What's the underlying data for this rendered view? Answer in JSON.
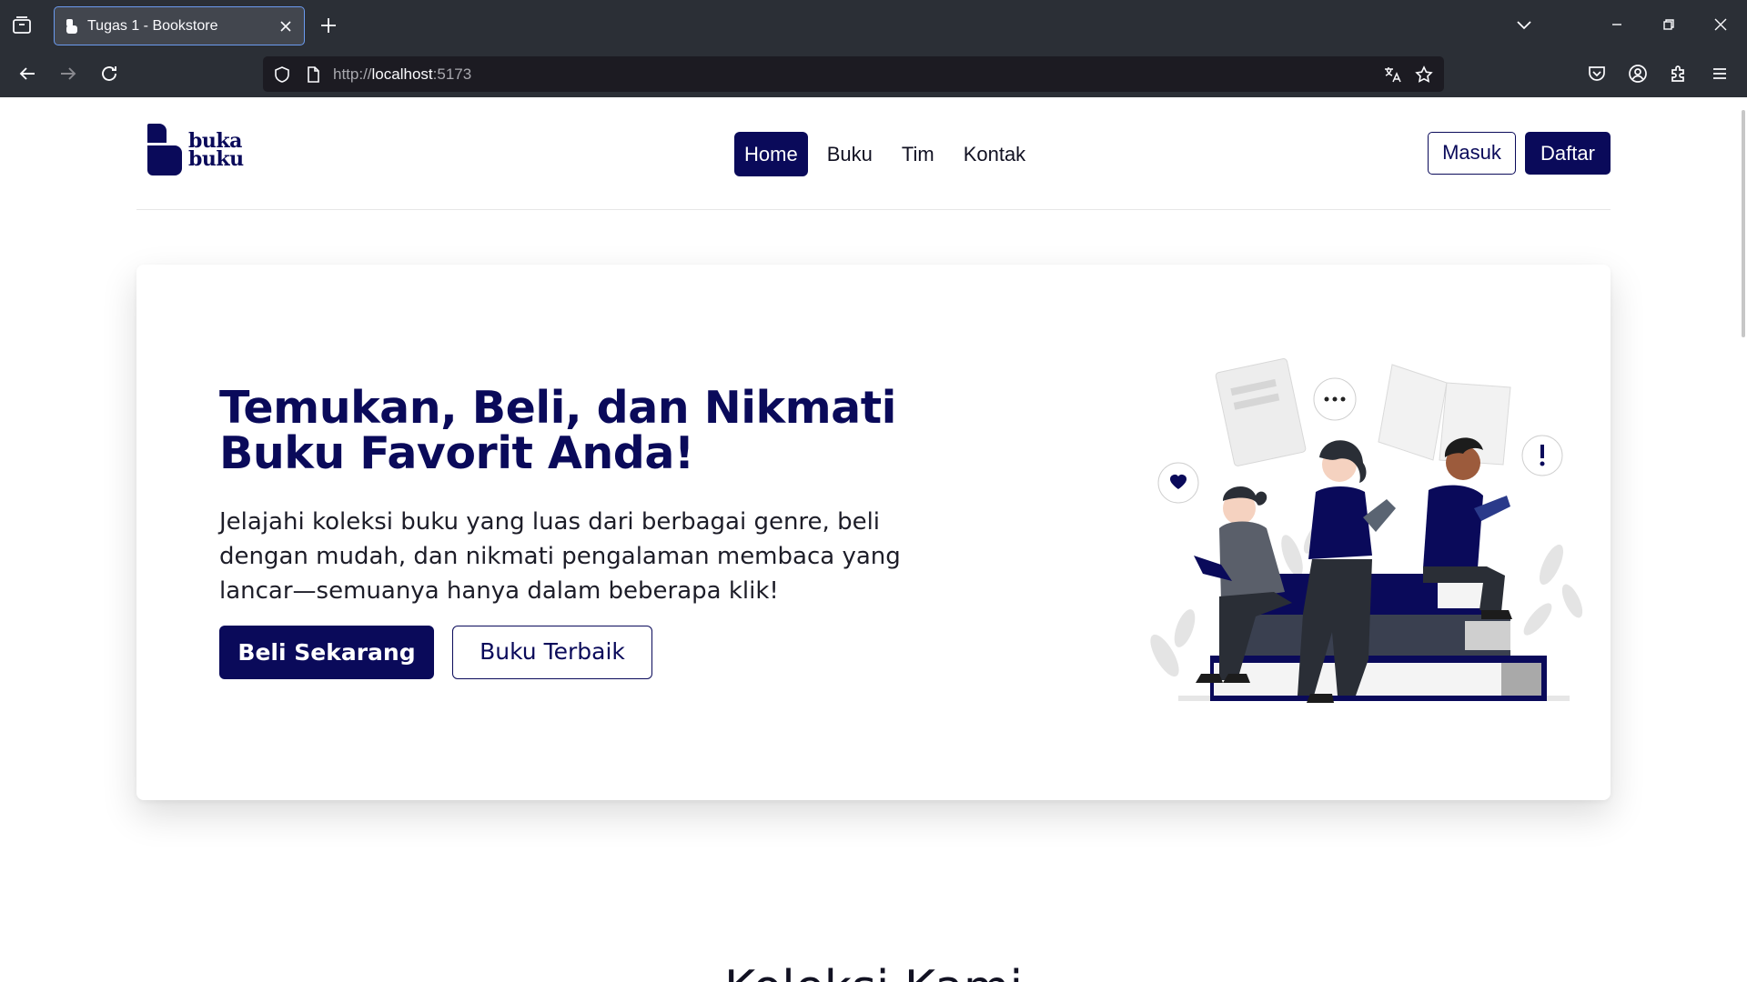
{
  "browser": {
    "tab_title": "Tugas 1 - Bookstore",
    "url_prefix": "http://",
    "url_host": "localhost",
    "url_port": ":5173"
  },
  "site": {
    "logo_line1": "buka",
    "logo_line2": "buku",
    "nav": [
      "Home",
      "Buku",
      "Tim",
      "Kontak"
    ],
    "login_label": "Masuk",
    "register_label": "Daftar"
  },
  "hero": {
    "heading_line1": "Temukan, Beli, dan Nikmati",
    "heading_line2": "Buku Favorit Anda!",
    "description": "Jelajahi koleksi buku yang luas dari berbagai genre, beli dengan mudah, dan nikmati pengalaman membaca yang lancar—semuanya hanya dalam beberapa klik!",
    "buy_label": "Beli Sekarang",
    "best_label": "Buku Terbaik"
  },
  "collection": {
    "title": "Koleksi Kami"
  },
  "colors": {
    "brand": "#0a0a5a",
    "chrome": "#2b2f36",
    "urlbar": "#1c1b22"
  }
}
